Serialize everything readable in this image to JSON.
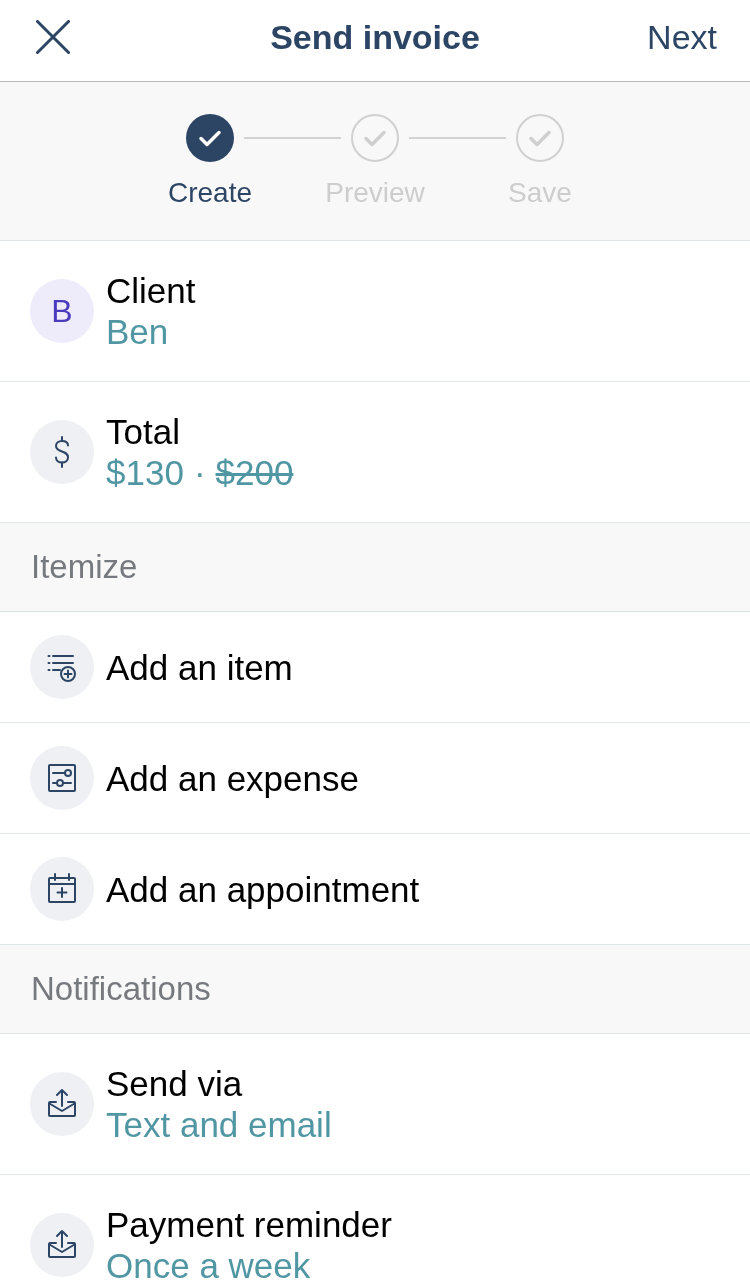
{
  "header": {
    "title": "Send invoice",
    "action": "Next"
  },
  "steps": [
    {
      "label": "Create",
      "completed": true
    },
    {
      "label": "Preview",
      "completed": false
    },
    {
      "label": "Save",
      "completed": false
    }
  ],
  "sections": [
    {
      "rows": [
        {
          "kind": "client",
          "initial": "B",
          "label": "Client",
          "value": "Ben"
        },
        {
          "kind": "total",
          "label": "Total",
          "value": "$130",
          "separator": "·",
          "struck_value": "$200"
        }
      ]
    },
    {
      "title": "Itemize",
      "rows": [
        {
          "kind": "item",
          "label": "Add an item"
        },
        {
          "kind": "expense",
          "label": "Add an expense"
        },
        {
          "kind": "appointment",
          "label": "Add an appointment"
        }
      ]
    },
    {
      "title": "Notifications",
      "rows": [
        {
          "kind": "send",
          "label": "Send via",
          "value": "Text and email"
        },
        {
          "kind": "reminder",
          "label": "Payment reminder",
          "value": "Once a week"
        }
      ]
    }
  ]
}
